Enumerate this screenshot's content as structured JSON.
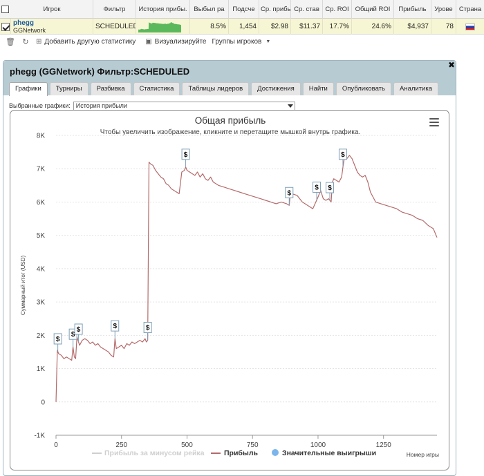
{
  "grid": {
    "headers": [
      "Игрок",
      "Фильтр",
      "История прибы.",
      "Выбыл ра",
      "Подсче",
      "Ср. прибы",
      "Ср. став",
      "Ср. ROI",
      "Общий ROI",
      "Прибыль",
      "Урове",
      "Страна"
    ],
    "row": {
      "checked": true,
      "player_name": "phegg",
      "network": "GGNetwork",
      "filter": "SCHEDULED",
      "itm_pct": "8.5%",
      "count": "1,454",
      "avg_profit": "$2.98",
      "avg_stake": "$11.37",
      "avg_roi": "17.7%",
      "total_roi": "24.6%",
      "profit": "$4,937",
      "level": "78",
      "country_flag": "russia-flag"
    }
  },
  "toolbar": {
    "add_stats": "Добавить другую статистику",
    "visualize": "Визуализируйте",
    "player_groups": "Группы игроков"
  },
  "dialog": {
    "title": "phegg (GGNetwork) Фильтр:SCHEDULED",
    "tabs": [
      "Графики",
      "Турниры",
      "Разбивка",
      "Статистика",
      "Таблицы лидеров",
      "Достижения",
      "Найти",
      "Опубликовать",
      "Аналитика"
    ],
    "selector_label": "Выбранные графики:",
    "selector_value": "История прибыли"
  },
  "colors": {
    "profit_line": "#b56a6a",
    "rake_line": "#cfcfcf",
    "big_win_marker": "#7cb5ec",
    "row_highlight": "#f7f6d4",
    "header_bg": "#b7cbd3",
    "sparkline": "#5cb85c"
  },
  "chart_data": {
    "type": "line",
    "title": "Общая прибыль",
    "subtitle": "Чтобы увеличить изображение, кликните и перетащите мышкой внутрь графика.",
    "xlabel": "Номер игры",
    "ylabel": "Суммарный итог (USD)",
    "xlim": [
      0,
      1454
    ],
    "ylim": [
      -1000,
      8000
    ],
    "x_ticks": [
      "0",
      "250",
      "500",
      "750",
      "1000",
      "1250"
    ],
    "y_ticks": [
      "-1K",
      "0",
      "1K",
      "2K",
      "3K",
      "4K",
      "5K",
      "6K",
      "7K",
      "8K"
    ],
    "grid": true,
    "legend_position": "bottom",
    "legend": [
      "Прибыль за минусом рейка",
      "Прибыль",
      "Значительные выигрыши"
    ],
    "series": [
      {
        "name": "Прибыль",
        "x": [
          0,
          5,
          10,
          20,
          30,
          40,
          50,
          60,
          65,
          70,
          75,
          80,
          90,
          100,
          110,
          120,
          130,
          140,
          150,
          160,
          170,
          180,
          190,
          200,
          210,
          220,
          225,
          230,
          240,
          250,
          260,
          270,
          280,
          290,
          300,
          310,
          320,
          330,
          340,
          345,
          350,
          355,
          360,
          370,
          380,
          390,
          400,
          410,
          420,
          430,
          440,
          450,
          460,
          470,
          480,
          490,
          495,
          500,
          510,
          520,
          530,
          540,
          550,
          560,
          570,
          580,
          590,
          600,
          620,
          640,
          660,
          680,
          700,
          720,
          740,
          760,
          780,
          800,
          820,
          840,
          860,
          880,
          890,
          895,
          900,
          920,
          940,
          960,
          980,
          1000,
          1010,
          1020,
          1030,
          1040,
          1050,
          1055,
          1060,
          1070,
          1080,
          1090,
          1095,
          1100,
          1110,
          1120,
          1130,
          1140,
          1150,
          1160,
          1170,
          1180,
          1190,
          1200,
          1220,
          1240,
          1260,
          1280,
          1300,
          1320,
          1340,
          1360,
          1380,
          1400,
          1420,
          1440,
          1454
        ],
        "values": [
          0,
          1550,
          1450,
          1400,
          1300,
          1350,
          1300,
          1250,
          1650,
          1350,
          1300,
          1950,
          1700,
          1850,
          1900,
          1850,
          1750,
          1800,
          1700,
          1750,
          1650,
          1600,
          1550,
          1500,
          1400,
          1350,
          1900,
          1600,
          1650,
          1700,
          1600,
          1750,
          1700,
          1800,
          1750,
          1800,
          1850,
          1800,
          1900,
          1800,
          1850,
          7200,
          7150,
          7100,
          6950,
          6850,
          6750,
          6700,
          6550,
          6500,
          6400,
          6350,
          6300,
          6250,
          6900,
          6950,
          7050,
          6950,
          6900,
          6850,
          6800,
          6900,
          6750,
          6850,
          6700,
          6650,
          6750,
          6600,
          6500,
          6450,
          6400,
          6350,
          6300,
          6250,
          6200,
          6150,
          6100,
          6050,
          6000,
          5950,
          6000,
          5950,
          5900,
          6300,
          6250,
          6200,
          6000,
          5900,
          5800,
          6150,
          6350,
          6100,
          6050,
          6100,
          6000,
          6600,
          6700,
          6650,
          6600,
          6750,
          7050,
          7300,
          7300,
          7400,
          7300,
          7100,
          6900,
          6800,
          6750,
          6800,
          6600,
          6300,
          6000,
          5950,
          5900,
          5850,
          5800,
          5700,
          5650,
          5600,
          5500,
          5450,
          5300,
          5200,
          4937
        ]
      }
    ],
    "big_wins_x": [
      7,
      65,
      86,
      225,
      350,
      495,
      890,
      995,
      1045,
      1095
    ],
    "big_wins_label": "$"
  }
}
